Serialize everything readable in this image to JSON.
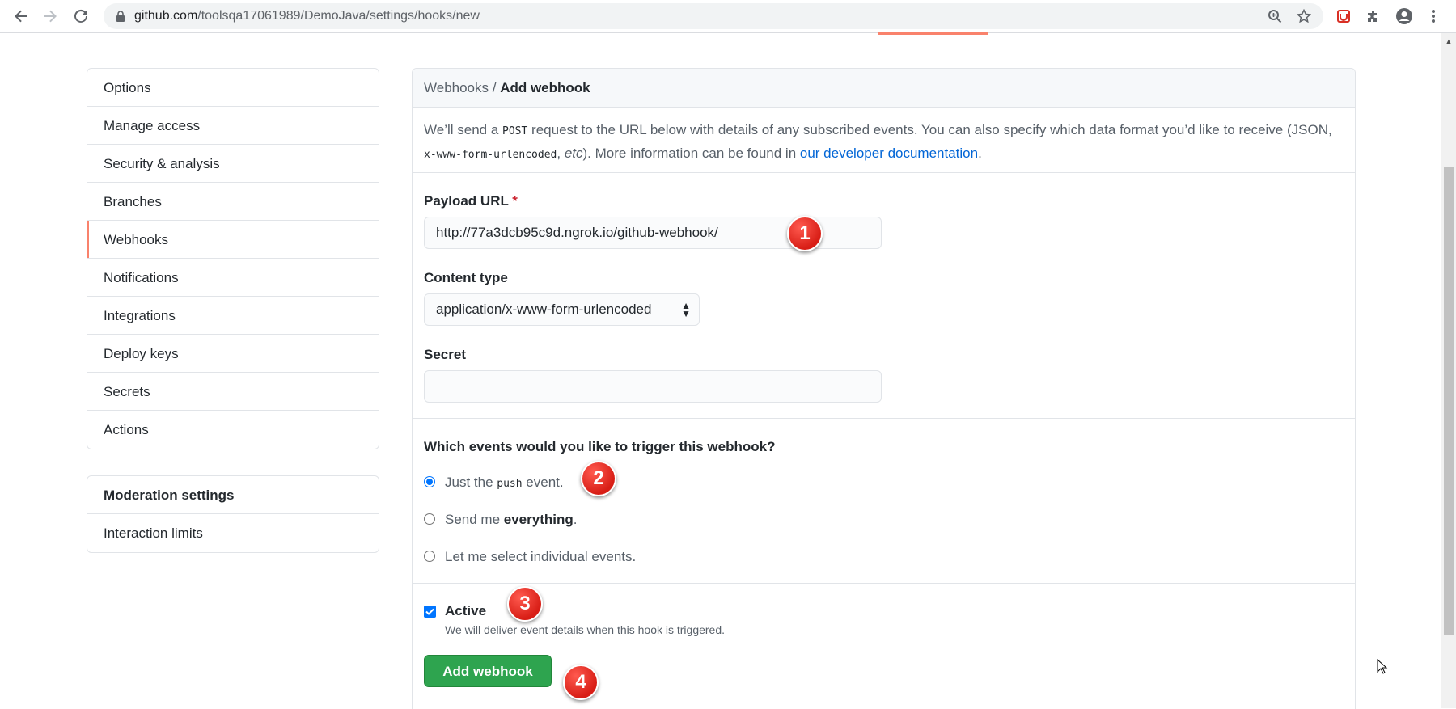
{
  "browser": {
    "url_domain": "github.com",
    "url_path": "/toolsqa17061989/DemoJava/settings/hooks/new"
  },
  "sidebar": {
    "items": [
      {
        "label": "Options"
      },
      {
        "label": "Manage access"
      },
      {
        "label": "Security & analysis"
      },
      {
        "label": "Branches"
      },
      {
        "label": "Webhooks",
        "selected": true
      },
      {
        "label": "Notifications"
      },
      {
        "label": "Integrations"
      },
      {
        "label": "Deploy keys"
      },
      {
        "label": "Secrets"
      },
      {
        "label": "Actions"
      }
    ],
    "moderation": {
      "heading": "Moderation settings",
      "items": [
        {
          "label": "Interaction limits"
        }
      ]
    }
  },
  "main": {
    "breadcrumb": {
      "parent": "Webhooks",
      "separator": " / ",
      "current": "Add webhook"
    },
    "intro": {
      "part1": "We’ll send a ",
      "code1": "POST",
      "part2": " request to the URL below with details of any subscribed events. You can also specify which data format you’d like to receive (JSON, ",
      "code2": "x-www-form-urlencoded",
      "part3": ", ",
      "etc": "etc",
      "part4": "). More information can be found in ",
      "link": "our developer documentation",
      "part5": "."
    },
    "payload_url": {
      "label": "Payload URL",
      "required_mark": "*",
      "value": "http://77a3dcb95c9d.ngrok.io/github-webhook/"
    },
    "content_type": {
      "label": "Content type",
      "value": "application/x-www-form-urlencoded"
    },
    "secret": {
      "label": "Secret",
      "value": ""
    },
    "events": {
      "question": "Which events would you like to trigger this webhook?",
      "options": [
        {
          "pre": "Just the ",
          "code": "push",
          "post": " event.",
          "checked": true
        },
        {
          "pre": "Send me ",
          "bold": "everything",
          "post": ".",
          "checked": false
        },
        {
          "pre": "Let me select individual events.",
          "checked": false
        }
      ]
    },
    "active": {
      "label": "Active",
      "note": "We will deliver event details when this hook is triggered.",
      "checked": true
    },
    "submit_label": "Add webhook"
  },
  "annotations": [
    "1",
    "2",
    "3",
    "4"
  ],
  "colors": {
    "accent": "#f9826c",
    "primary_button": "#2ea44f",
    "link": "#0366d6",
    "marker": "#d81e16"
  }
}
